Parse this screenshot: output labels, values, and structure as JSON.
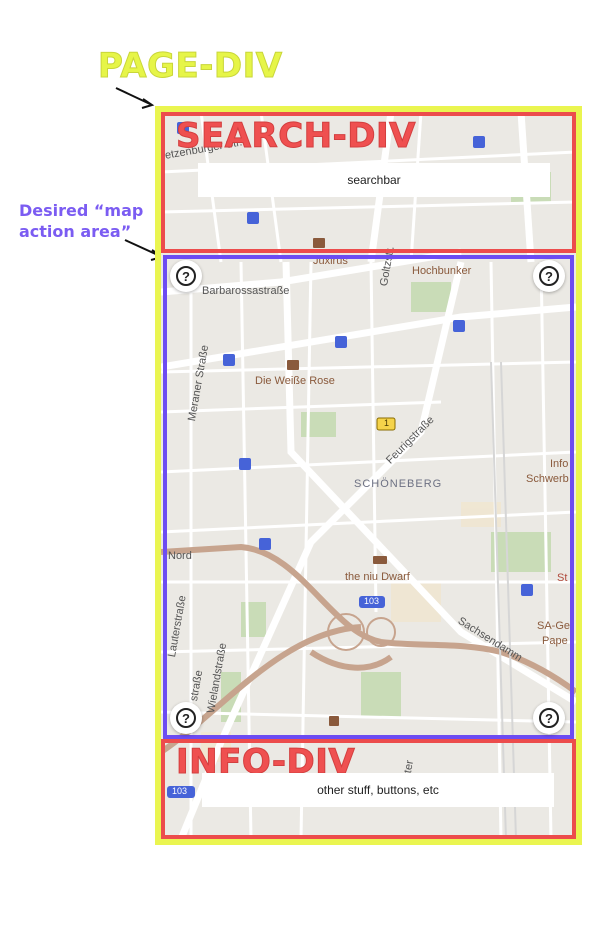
{
  "annotations": {
    "page_label": "PAGE-DIV",
    "desired_label": "Desired “map action area”",
    "search_label": "SEARCH-DIV",
    "info_label": "INFO-DIV"
  },
  "searchbar": {
    "text": "searchbar"
  },
  "infobar": {
    "text": "other stuff, buttons, etc"
  },
  "help_symbol": "?",
  "map": {
    "streets": {
      "barbarossa": "Barbarossastraße",
      "meraner": "Meraner Straße",
      "feurig": "Feurigstraße",
      "goltz": "Goltzstr.",
      "sachsendamm": "Sachsendamm",
      "wieland": "Wielandstraße",
      "lauter": "Lauterstraße",
      "str": "straße",
      "eisenzahn": "etzenburger Str.",
      "nord": "Nord",
      "werder": "ter"
    },
    "pois": {
      "hochbunker": "Hochbunker",
      "weisse_rose": "Die Weiße Rose",
      "niu_dwarf": "the niu Dwarf",
      "info": "Info",
      "schwerb": "Schwerb",
      "st": "St",
      "sa_ge": "SA-Ge",
      "pape": "Pape",
      "juxirus": "Juxirus"
    },
    "district": "SCHÖNEBERG",
    "road_badges": {
      "b1": "1",
      "a103": "103",
      "a103b": "103"
    },
    "colors": {
      "highway": "#c7a48e",
      "water": "#aad3df",
      "park": "#c9dcb7"
    }
  }
}
